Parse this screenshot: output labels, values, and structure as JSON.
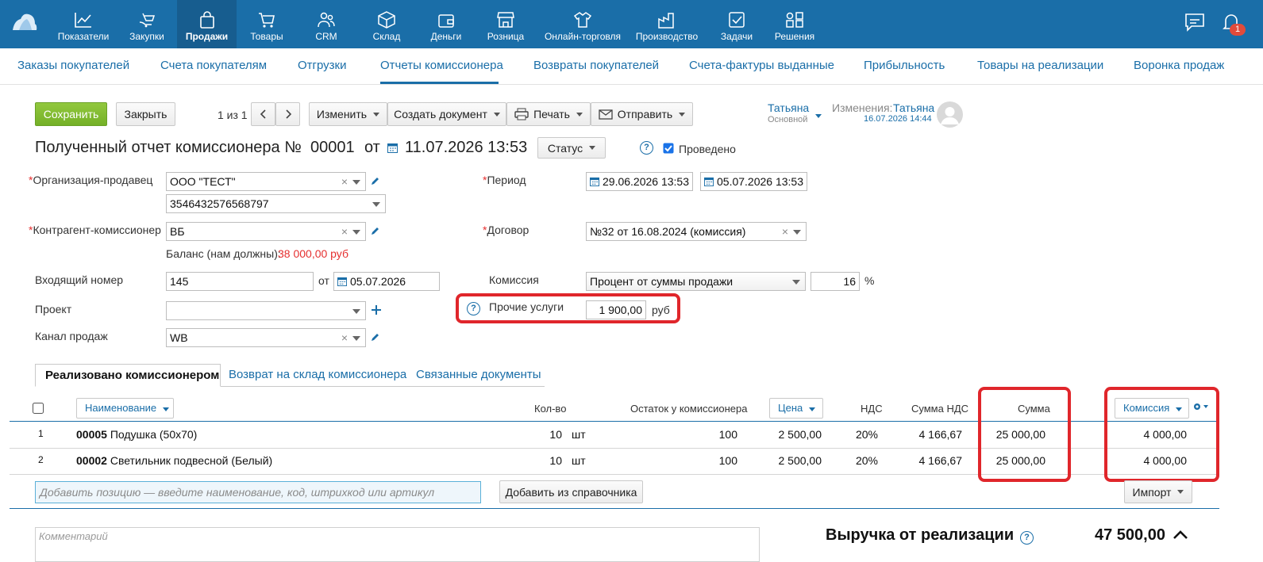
{
  "topnav": {
    "items": [
      {
        "label": "Показатели",
        "icon": "chart-line-icon"
      },
      {
        "label": "Закупки",
        "icon": "basket-hand-icon"
      },
      {
        "label": "Продажи",
        "icon": "shopping-bag-icon",
        "active": true
      },
      {
        "label": "Товары",
        "icon": "cart-icon"
      },
      {
        "label": "CRM",
        "icon": "people-icon"
      },
      {
        "label": "Склад",
        "icon": "box-icon"
      },
      {
        "label": "Деньги",
        "icon": "wallet-icon"
      },
      {
        "label": "Розница",
        "icon": "store-icon"
      },
      {
        "label": "Онлайн-торговля",
        "icon": "shirt-tag-icon"
      },
      {
        "label": "Производство",
        "icon": "factory-icon"
      },
      {
        "label": "Задачи",
        "icon": "checkbox-icon"
      },
      {
        "label": "Решения",
        "icon": "apps-icon"
      }
    ],
    "notification_count": "1"
  },
  "subnav": {
    "items": [
      "Заказы покупателей",
      "Счета покупателям",
      "Отгрузки",
      "Отчеты комиссионера",
      "Возвраты покупателей",
      "Счета-фактуры выданные",
      "Прибыльность",
      "Товары на реализации",
      "Воронка продаж"
    ],
    "active": "Отчеты комиссионера"
  },
  "toolbar": {
    "save": "Сохранить",
    "close": "Закрыть",
    "pager": "1 из 1",
    "edit": "Изменить",
    "create_doc": "Создать документ",
    "print": "Печать",
    "send": "Отправить"
  },
  "user": {
    "name": "Татьяна",
    "role": "Основной",
    "changes_label": "Изменения:",
    "changes_user": "Татьяна",
    "changes_time": "16.07.2026 14:44"
  },
  "doc": {
    "title": "Полученный отчет комиссионера №",
    "number": "00001",
    "from": "от",
    "date": "11.07.2026 13:53",
    "status": "Статус",
    "posted": "Проведено"
  },
  "form": {
    "org_label": "Организация-продавец",
    "org_value": "ООО \"ТЕСТ\"",
    "account_value": "3546432576568797",
    "contractor_label": "Контрагент-комиссионер",
    "contractor_value": "ВБ",
    "balance_label": "Баланс (нам должны):",
    "balance_value": "38 000,00 руб",
    "incoming_label": "Входящий номер",
    "incoming_value": "145",
    "incoming_from": "от",
    "incoming_date": "05.07.2026",
    "project_label": "Проект",
    "project_value": "",
    "channel_label": "Канал продаж",
    "channel_value": "WB",
    "period_label": "Период",
    "period_from": "29.06.2026 13:53",
    "period_to": "05.07.2026 13:53",
    "contract_label": "Договор",
    "contract_value": "№32 от 16.08.2024 (комиссия)",
    "commission_label": "Комиссия",
    "commission_type": "Процент от суммы продажи",
    "commission_percent": "16",
    "percent_sign": "%",
    "other_services_label": "Прочие услуги",
    "other_services_value": "1 900,00",
    "currency": "руб"
  },
  "tabs": [
    "Реализовано комиссионером",
    "Возврат на склад комиссионера",
    "Связанные документы"
  ],
  "table": {
    "headers": {
      "name": "Наименование",
      "qty": "Кол-во",
      "remainder": "Остаток у комиссионера",
      "price": "Цена",
      "vat": "НДС",
      "vat_sum": "Сумма НДС",
      "sum": "Сумма",
      "commission": "Комиссия"
    },
    "rows": [
      {
        "n": "1",
        "code": "00005",
        "name": "Подушка (50х70)",
        "qty": "10",
        "unit": "шт",
        "remainder": "100",
        "price": "2 500,00",
        "vat": "20%",
        "vat_sum": "4 166,67",
        "sum": "25 000,00",
        "commission": "4 000,00"
      },
      {
        "n": "2",
        "code": "00002",
        "name": "Светильник подвесной (Белый)",
        "qty": "10",
        "unit": "шт",
        "remainder": "100",
        "price": "2 500,00",
        "vat": "20%",
        "vat_sum": "4 166,67",
        "sum": "25 000,00",
        "commission": "4 000,00"
      }
    ],
    "add_placeholder": "Добавить позицию — введите наименование, код, штрихкод или артикул",
    "add_from_catalog": "Добавить из справочника",
    "import": "Импорт"
  },
  "footer": {
    "comment_placeholder": "Комментарий",
    "revenue_label": "Выручка от реализации",
    "revenue_value": "47 500,00"
  },
  "colors": {
    "topbar": "#1a6ea8",
    "accent": "#1a6ea8",
    "save_button": "#7ab52d",
    "highlight": "#e0262b",
    "balance": "#e52f2f"
  }
}
